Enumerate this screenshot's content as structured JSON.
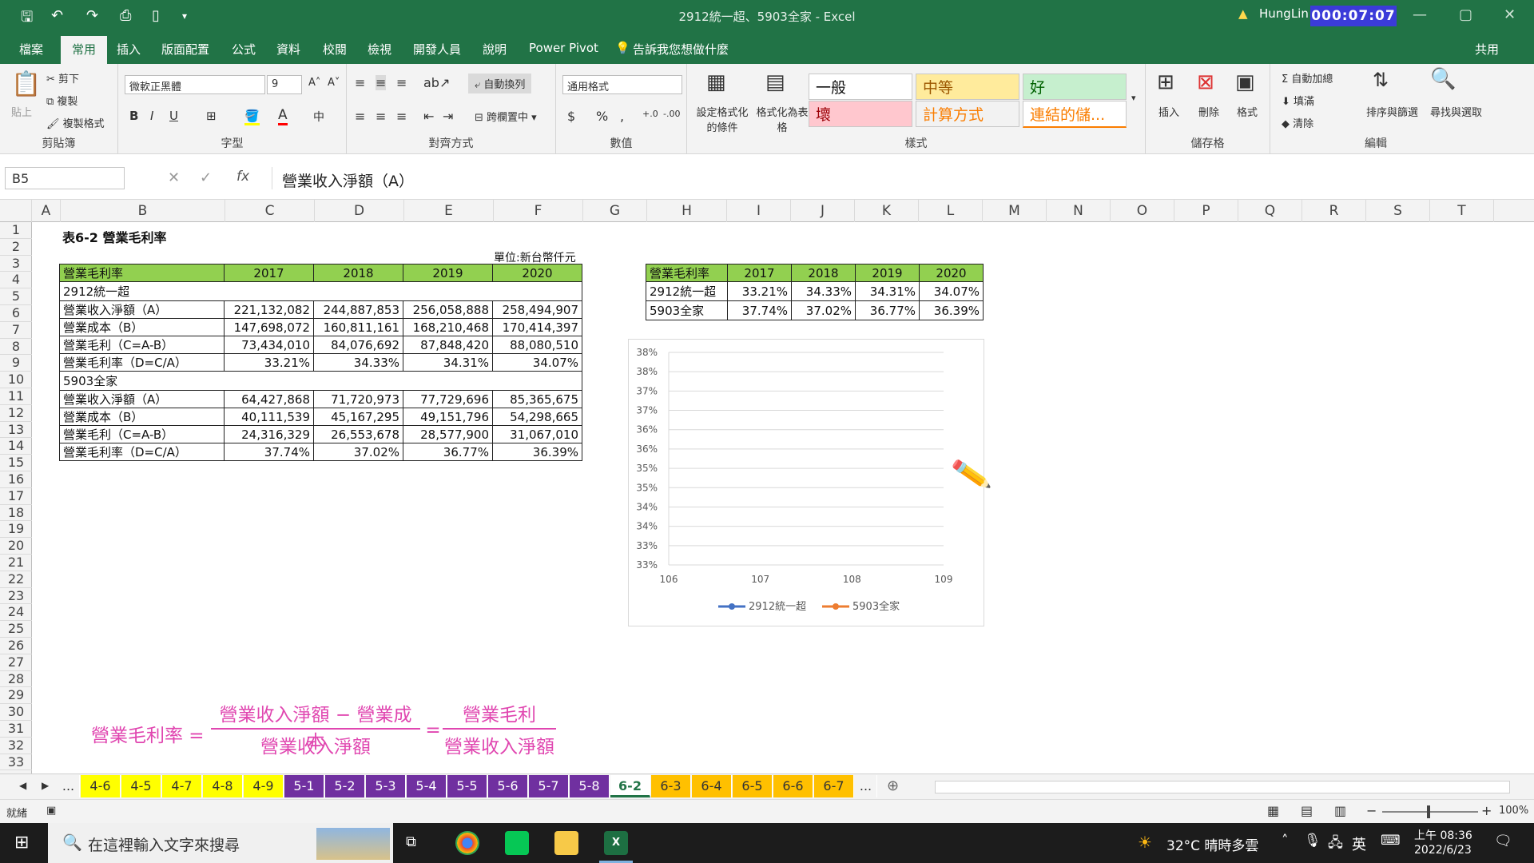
{
  "app": {
    "title": "2912統一超、5903全家  -  Excel",
    "user": "HungLin",
    "clock": "000:07:07",
    "qa_icons": [
      "save-icon",
      "undo-icon",
      "redo-icon",
      "print-preview-icon",
      "new-file-icon",
      "customize-icon"
    ]
  },
  "ribbon_tabs": [
    "檔案",
    "常用",
    "插入",
    "版面配置",
    "公式",
    "資料",
    "校閱",
    "檢視",
    "開發人員",
    "說明",
    "Power Pivot",
    "告訴我您想做什麼",
    "共用"
  ],
  "ribbon": {
    "clipboard": {
      "label": "剪貼簿",
      "paste": "貼上",
      "cut": "剪下",
      "copy": "複製",
      "format_painter": "複製格式"
    },
    "font": {
      "label": "字型",
      "name": "微軟正黑體",
      "size": "9",
      "bold": "B",
      "italic": "I",
      "underline": "U"
    },
    "alignment": {
      "label": "對齊方式",
      "wrap": "自動換列",
      "merge": "跨欄置中"
    },
    "number": {
      "label": "數值",
      "format": "通用格式",
      "currency": "$",
      "percent": "%",
      "comma": ","
    },
    "styles": {
      "label": "樣式",
      "cond_fmt": "設定格式化的條件",
      "as_table": "格式化為表格",
      "normal": "一般",
      "neutral": "中等",
      "good": "好",
      "bad": "壞",
      "calc": "計算方式",
      "link": "連結的儲..."
    },
    "cells": {
      "label": "儲存格",
      "insert": "插入",
      "delete": "刪除",
      "format": "格式"
    },
    "editing": {
      "label": "編輯",
      "autosum": "自動加總",
      "fill": "填滿",
      "clear": "清除",
      "sort": "排序與篩選",
      "find": "尋找與選取"
    }
  },
  "formula_bar": {
    "name_box": "B5",
    "content": "營業收入淨額（A）",
    "fx": "fx"
  },
  "columns": [
    "A",
    "B",
    "C",
    "D",
    "E",
    "F",
    "G",
    "H",
    "I",
    "J",
    "K",
    "L",
    "M",
    "N",
    "O",
    "P",
    "Q",
    "R",
    "S",
    "T"
  ],
  "rows": [
    "1",
    "2",
    "3",
    "4",
    "5",
    "6",
    "7",
    "8",
    "9",
    "10",
    "11",
    "12",
    "13",
    "14",
    "15",
    "16",
    "17",
    "18",
    "19",
    "20",
    "21",
    "22",
    "23",
    "24",
    "25",
    "26",
    "27",
    "28",
    "29",
    "30",
    "31",
    "32",
    "33"
  ],
  "sheet": {
    "title": "表6-2 營業毛利率",
    "unit": "單位:新台幣仟元",
    "main_table": {
      "header": [
        "營業毛利率",
        "2017",
        "2018",
        "2019",
        "2020"
      ],
      "rows": [
        [
          "2912統一超"
        ],
        [
          "營業收入淨額（A）",
          "221,132,082",
          "244,887,853",
          "256,058,888",
          "258,494,907"
        ],
        [
          "營業成本（B）",
          "147,698,072",
          "160,811,161",
          "168,210,468",
          "170,414,397"
        ],
        [
          "營業毛利（C=A-B）",
          "73,434,010",
          "84,076,692",
          "87,848,420",
          "88,080,510"
        ],
        [
          "營業毛利率（D=C/A）",
          "33.21%",
          "34.33%",
          "34.31%",
          "34.07%"
        ],
        [
          "5903全家"
        ],
        [
          "營業收入淨額（A）",
          "64,427,868",
          "71,720,973",
          "77,729,696",
          "85,365,675"
        ],
        [
          "營業成本（B）",
          "40,111,539",
          "45,167,295",
          "49,151,796",
          "54,298,665"
        ],
        [
          "營業毛利（C=A-B）",
          "24,316,329",
          "26,553,678",
          "28,577,900",
          "31,067,010"
        ],
        [
          "營業毛利率（D=C/A）",
          "37.74%",
          "37.02%",
          "36.77%",
          "36.39%"
        ]
      ]
    },
    "summary_table": {
      "header": [
        "營業毛利率",
        "2017",
        "2018",
        "2019",
        "2020"
      ],
      "rows": [
        [
          "2912統一超",
          "33.21%",
          "34.33%",
          "34.31%",
          "34.07%"
        ],
        [
          "5903全家",
          "37.74%",
          "37.02%",
          "36.77%",
          "36.39%"
        ]
      ]
    },
    "formula": {
      "lhs": "營業毛利率 =",
      "num1": "營業收入淨額 − 營業成本",
      "den1": "營業收入淨額",
      "eq": "=",
      "num2": "營業毛利",
      "den2": "營業收入淨額"
    }
  },
  "chart_data": {
    "type": "line",
    "title": "",
    "x": [
      "106",
      "107",
      "108",
      "109"
    ],
    "y_ticks": [
      "33%",
      "33%",
      "34%",
      "34%",
      "35%",
      "35%",
      "36%",
      "36%",
      "37%",
      "37%",
      "38%",
      "38%"
    ],
    "ylim": [
      0.33,
      0.385
    ],
    "series": [
      {
        "name": "2912統一超",
        "color": "#4472c4",
        "values": []
      },
      {
        "name": "5903全家",
        "color": "#ed7d31",
        "values": []
      }
    ],
    "grid": true,
    "legend": "bottom"
  },
  "sheet_tabs": [
    {
      "n": "...",
      "c": "#f3f3f3",
      "t": "#333"
    },
    {
      "n": "4-6",
      "c": "#ffff00",
      "t": "#333"
    },
    {
      "n": "4-5",
      "c": "#ffff00",
      "t": "#333"
    },
    {
      "n": "4-7",
      "c": "#ffff00",
      "t": "#333"
    },
    {
      "n": "4-8",
      "c": "#ffff00",
      "t": "#333"
    },
    {
      "n": "4-9",
      "c": "#ffff00",
      "t": "#333"
    },
    {
      "n": "5-1",
      "c": "#7030a0",
      "t": "#fff"
    },
    {
      "n": "5-2",
      "c": "#7030a0",
      "t": "#fff"
    },
    {
      "n": "5-3",
      "c": "#7030a0",
      "t": "#fff"
    },
    {
      "n": "5-4",
      "c": "#7030a0",
      "t": "#fff"
    },
    {
      "n": "5-5",
      "c": "#7030a0",
      "t": "#fff"
    },
    {
      "n": "5-6",
      "c": "#7030a0",
      "t": "#fff"
    },
    {
      "n": "5-7",
      "c": "#7030a0",
      "t": "#fff"
    },
    {
      "n": "5-8",
      "c": "#7030a0",
      "t": "#fff"
    },
    {
      "n": "6-2",
      "c": "#ffffff",
      "t": "#217346"
    },
    {
      "n": "6-3",
      "c": "#ffc000",
      "t": "#333"
    },
    {
      "n": "6-4",
      "c": "#ffc000",
      "t": "#333"
    },
    {
      "n": "6-5",
      "c": "#ffc000",
      "t": "#333"
    },
    {
      "n": "6-6",
      "c": "#ffc000",
      "t": "#333"
    },
    {
      "n": "6-7",
      "c": "#ffc000",
      "t": "#333"
    },
    {
      "n": "...",
      "c": "#f3f3f3",
      "t": "#333"
    }
  ],
  "status": {
    "ready": "就緒",
    "zoom": "100%"
  },
  "taskbar": {
    "search": "在這裡輸入文字來搜尋",
    "weather": "32°C  晴時多雲",
    "ime": "英",
    "time": "上午 08:36",
    "date": "2022/6/23"
  }
}
